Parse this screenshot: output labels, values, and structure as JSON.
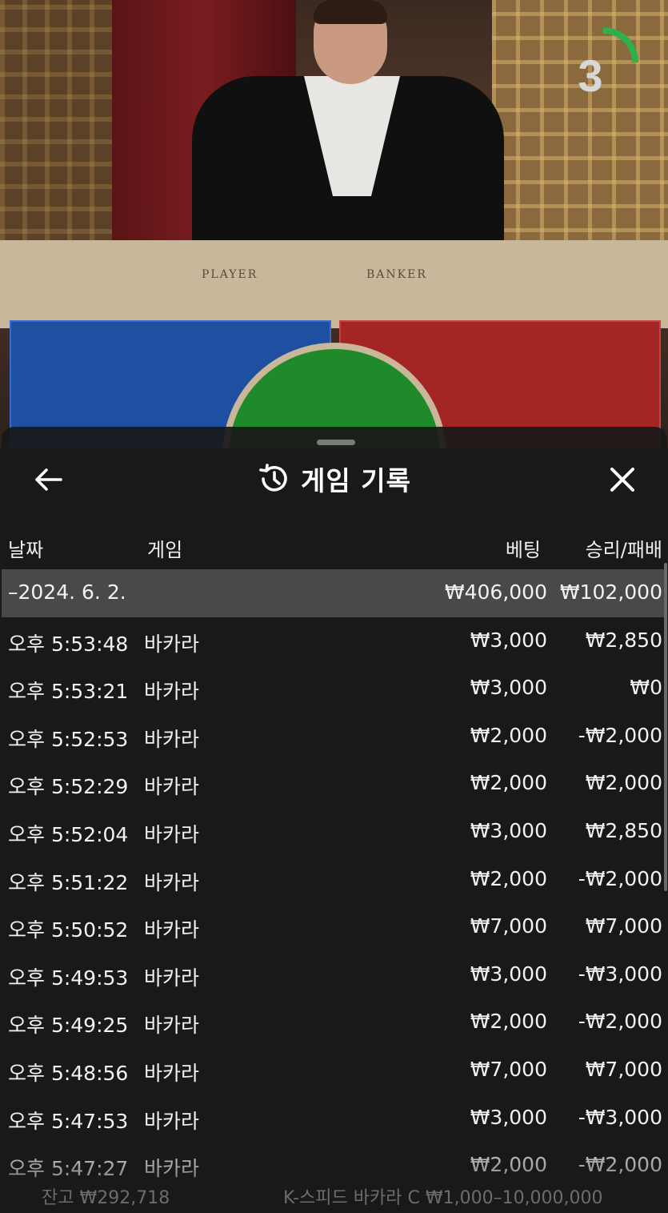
{
  "video": {
    "table_player_label": "PLAYER",
    "table_banker_label": "BANKER",
    "countdown": "3",
    "countdown_fraction": 0.25,
    "timer_color": "#2fb04a"
  },
  "panel": {
    "title": "게임 기록",
    "back_icon": "arrow-left-icon",
    "history_icon": "history-clock-icon",
    "close_icon": "close-icon"
  },
  "columns": {
    "date": "날짜",
    "game": "게임",
    "bet": "베팅",
    "result": "승리/패배"
  },
  "summary": {
    "date": "–2024. 6. 2.",
    "bet": "₩406,000",
    "result": "₩102,000"
  },
  "rows": [
    {
      "time": "오후 5:53:48",
      "game": "바카라",
      "bet": "₩3,000",
      "result": "₩2,850"
    },
    {
      "time": "오후 5:53:21",
      "game": "바카라",
      "bet": "₩3,000",
      "result": "₩0"
    },
    {
      "time": "오후 5:52:53",
      "game": "바카라",
      "bet": "₩2,000",
      "result": "-₩2,000"
    },
    {
      "time": "오후 5:52:29",
      "game": "바카라",
      "bet": "₩2,000",
      "result": "₩2,000"
    },
    {
      "time": "오후 5:52:04",
      "game": "바카라",
      "bet": "₩3,000",
      "result": "₩2,850"
    },
    {
      "time": "오후 5:51:22",
      "game": "바카라",
      "bet": "₩2,000",
      "result": "-₩2,000"
    },
    {
      "time": "오후 5:50:52",
      "game": "바카라",
      "bet": "₩7,000",
      "result": "₩7,000"
    },
    {
      "time": "오후 5:49:53",
      "game": "바카라",
      "bet": "₩3,000",
      "result": "-₩3,000"
    },
    {
      "time": "오후 5:49:25",
      "game": "바카라",
      "bet": "₩2,000",
      "result": "-₩2,000"
    },
    {
      "time": "오후 5:48:56",
      "game": "바카라",
      "bet": "₩7,000",
      "result": "₩7,000"
    },
    {
      "time": "오후 5:47:53",
      "game": "바카라",
      "bet": "₩3,000",
      "result": "-₩3,000"
    },
    {
      "time": "오후 5:47:27",
      "game": "바카라",
      "bet": "₩2,000",
      "result": "-₩2,000"
    }
  ],
  "footer": {
    "balance": "잔고 ₩292,718",
    "table_info": "K-스피드 바카라 C ₩1,000–10,000,000"
  }
}
